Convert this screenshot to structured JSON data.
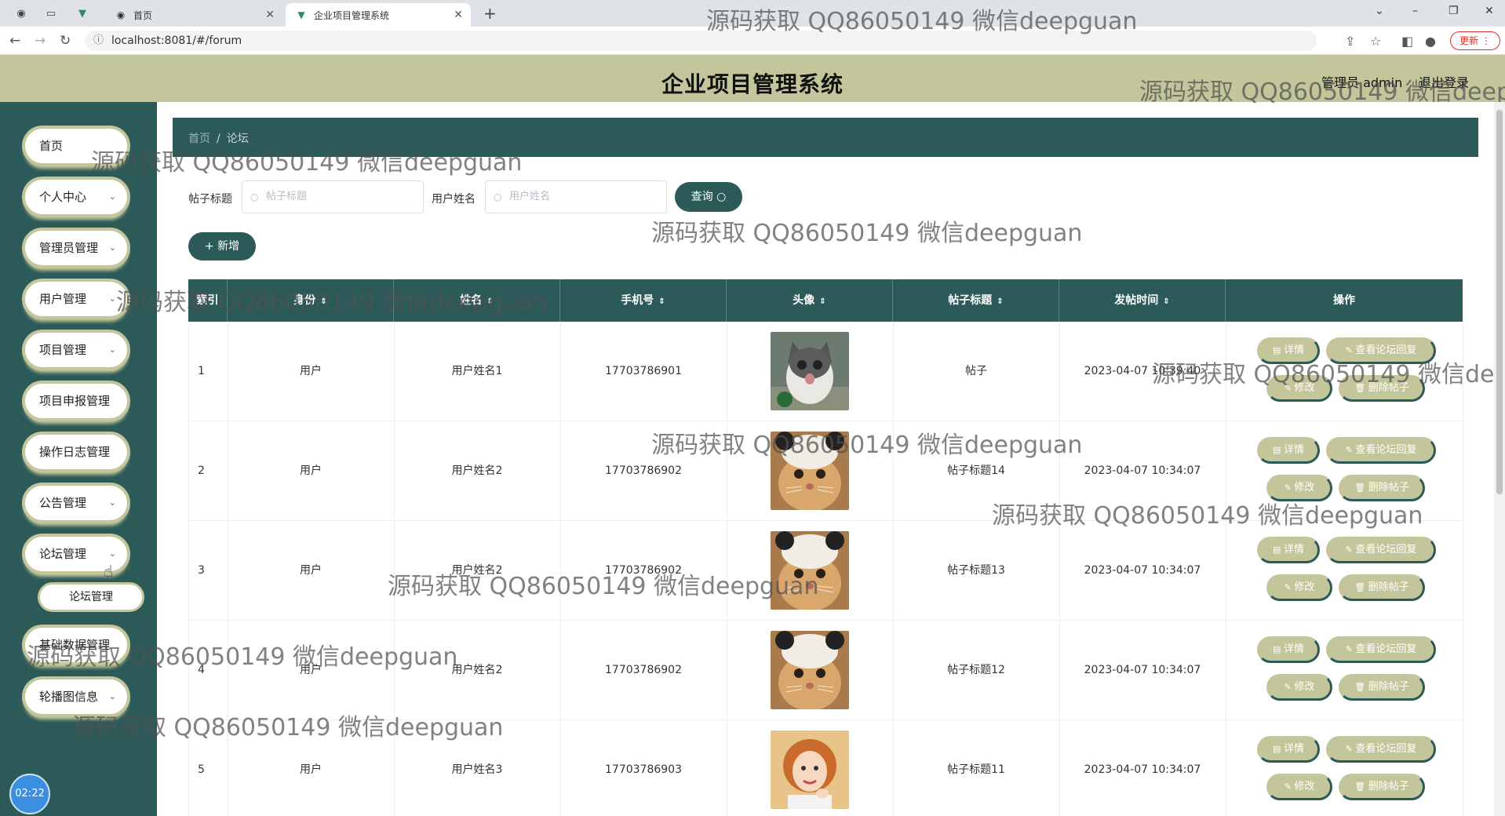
{
  "browser": {
    "tabs": [
      {
        "label": "首页",
        "active": false
      },
      {
        "label": "企业项目管理系统",
        "active": true
      }
    ],
    "url": "localhost:8081/#/forum",
    "update_label": "更新"
  },
  "header": {
    "title": "企业项目管理系统",
    "user_label": "管理员 admin",
    "logout_label": "退出登录",
    "background_color": "#c3c69a"
  },
  "sidebar": {
    "items": [
      {
        "label": "首页",
        "has_arrow": false
      },
      {
        "label": "个人中心",
        "has_arrow": true
      },
      {
        "label": "管理员管理",
        "has_arrow": true
      },
      {
        "label": "用户管理",
        "has_arrow": true
      },
      {
        "label": "项目管理",
        "has_arrow": true
      },
      {
        "label": "项目申报管理",
        "has_arrow": false
      },
      {
        "label": "操作日志管理",
        "has_arrow": false
      },
      {
        "label": "公告管理",
        "has_arrow": true
      },
      {
        "label": "论坛管理",
        "has_arrow": true
      },
      {
        "label": "基础数据管理",
        "has_arrow": false
      },
      {
        "label": "轮播图信息",
        "has_arrow": true
      }
    ],
    "sub_item": "论坛管理",
    "clock": "02:22",
    "background_color": "#2c5a59"
  },
  "breadcrumb": {
    "home": "首页",
    "separator": "/",
    "current": "论坛"
  },
  "search": {
    "title_label": "帖子标题",
    "title_placeholder": "帖子标题",
    "user_label": "用户姓名",
    "user_placeholder": "用户姓名",
    "query_label": "查询"
  },
  "add_label": "新增",
  "table": {
    "columns": [
      "索引",
      "身份",
      "姓名",
      "手机号",
      "头像",
      "帖子标题",
      "发帖时间",
      "操作"
    ],
    "rows": [
      {
        "index": "1",
        "role": "用户",
        "name": "用户姓名1",
        "phone": "17703786901",
        "avatar": "cat-gray",
        "title": "帖子",
        "time": "2023-04-07 10:39:40"
      },
      {
        "index": "2",
        "role": "用户",
        "name": "用户姓名2",
        "phone": "17703786902",
        "avatar": "cat-hat",
        "title": "帖子标题14",
        "time": "2023-04-07 10:34:07"
      },
      {
        "index": "3",
        "role": "用户",
        "name": "用户姓名2",
        "phone": "17703786902",
        "avatar": "cat-hat",
        "title": "帖子标题13",
        "time": "2023-04-07 10:34:07"
      },
      {
        "index": "4",
        "role": "用户",
        "name": "用户姓名2",
        "phone": "17703786902",
        "avatar": "cat-hat",
        "title": "帖子标题12",
        "time": "2023-04-07 10:34:07"
      },
      {
        "index": "5",
        "role": "用户",
        "name": "用户姓名3",
        "phone": "17703786903",
        "avatar": "girl",
        "title": "帖子标题11",
        "time": "2023-04-07 10:34:07"
      }
    ],
    "actions": {
      "detail": "详情",
      "view_replies": "查看论坛回复",
      "edit": "修改",
      "delete": "删除帖子"
    }
  },
  "watermark": "源码获取 QQ86050149 微信deepguan",
  "colors": {
    "primary": "#2c5a59",
    "accent": "#c3c69a"
  }
}
